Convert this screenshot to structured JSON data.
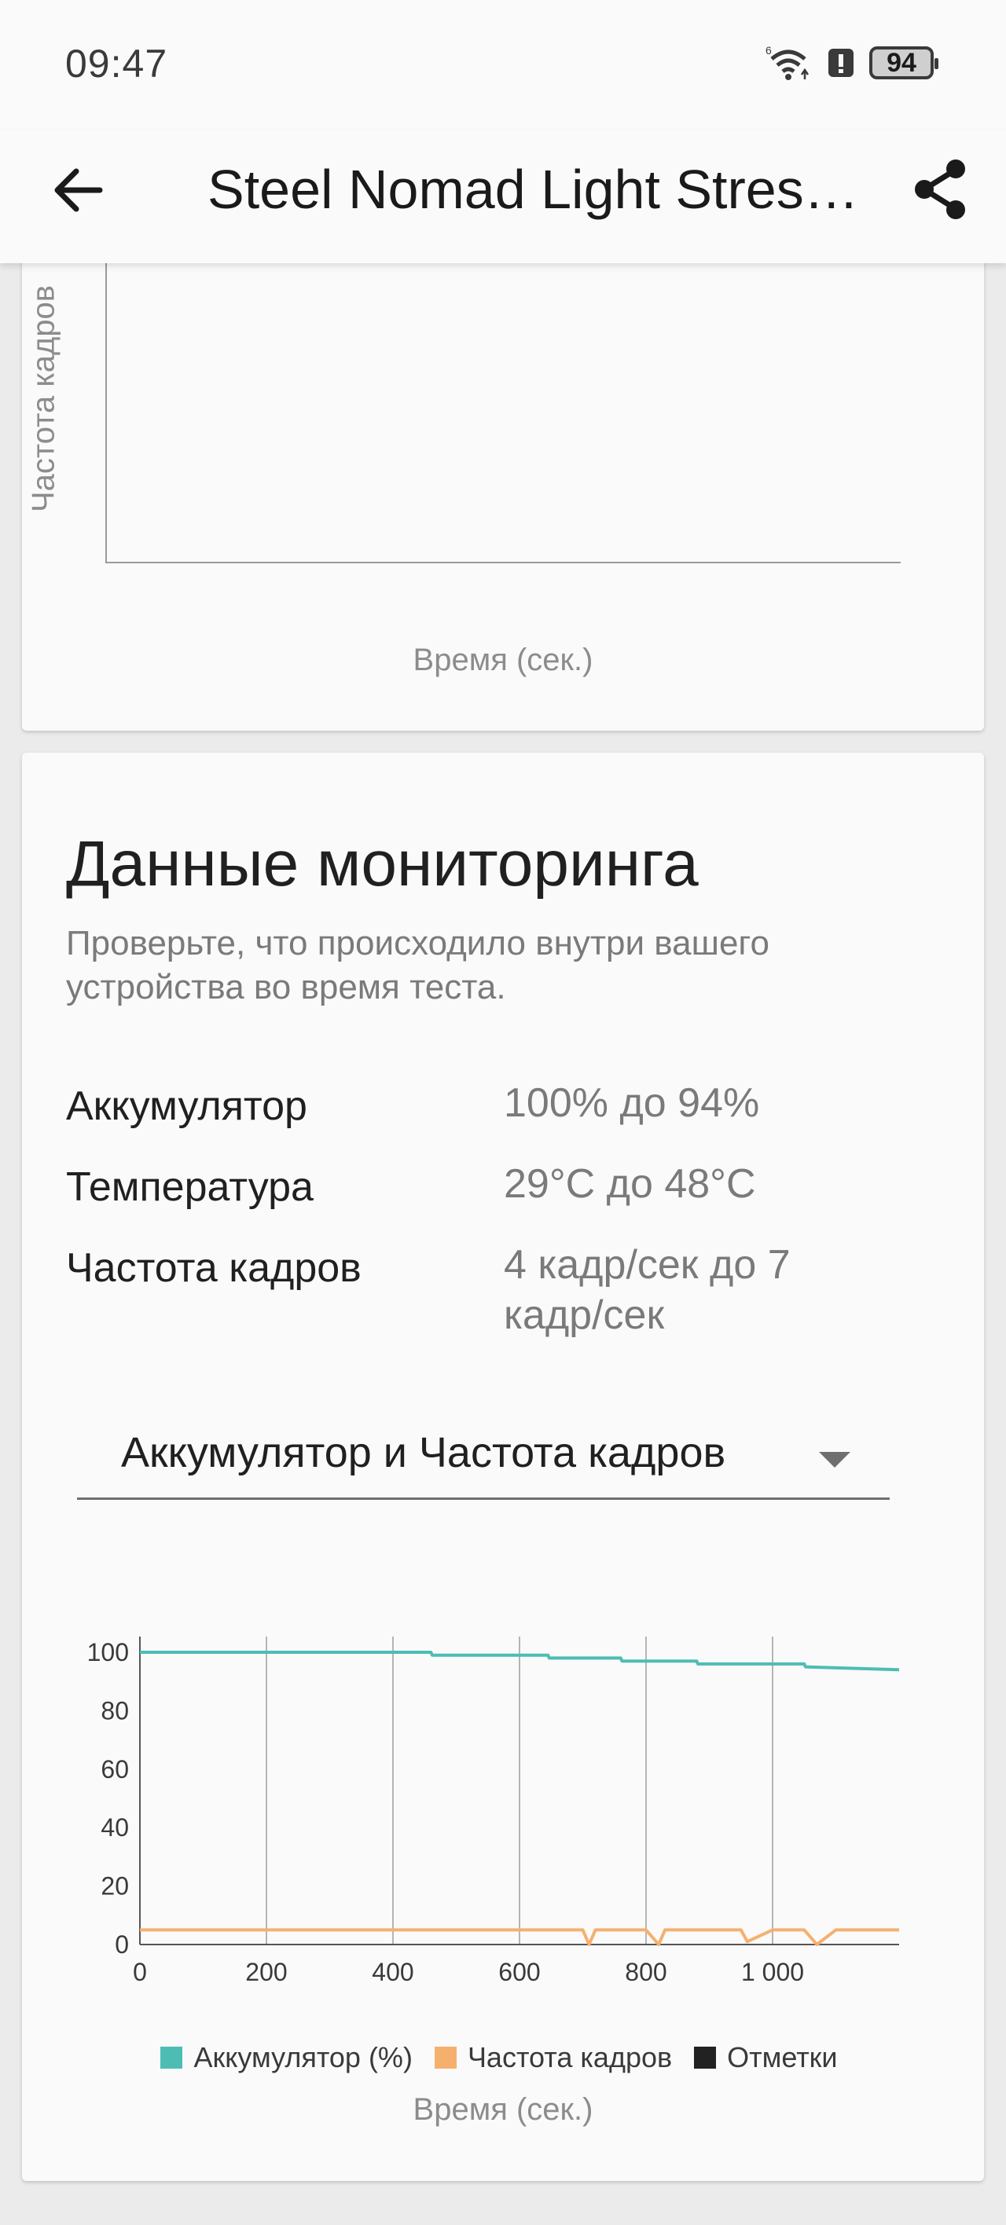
{
  "status": {
    "time": "09:47",
    "battery": "94"
  },
  "toolbar": {
    "title": "Steel Nomad Light Stres…"
  },
  "top_chart": {
    "y_label": "Частота кадров",
    "x_label": "Время (сек.)"
  },
  "monitoring": {
    "title": "Данные мониторинга",
    "subtitle": "Проверьте, что происходило внутри вашего устройства во время теста.",
    "stats": [
      {
        "label": "Аккумулятор",
        "value": "100% до 94%"
      },
      {
        "label": "Температура",
        "value": "29°C до 48°C"
      },
      {
        "label": "Частота кадров",
        "value": "4 кадр/сек до 7 кадр/сек"
      }
    ],
    "dropdown": {
      "selected": "Аккумулятор и Частота кадров"
    }
  },
  "colors": {
    "battery": "#4dbdb4",
    "fps": "#f5b06e",
    "marks": "#222222"
  },
  "chart_data": {
    "type": "line",
    "x_ticks": [
      "0",
      "200",
      "400",
      "600",
      "800",
      "1 000"
    ],
    "y_ticks": [
      "0",
      "20",
      "40",
      "60",
      "80",
      "100"
    ],
    "xlim": [
      0,
      1200
    ],
    "ylim": [
      0,
      100
    ],
    "grid": "vertical",
    "legend_position": "bottom",
    "xlabel": "Время (сек.)",
    "series": [
      {
        "name": "Аккумулятор (%)",
        "x": [
          0,
          460,
          462,
          645,
          647,
          760,
          762,
          880,
          882,
          1050,
          1052,
          1200
        ],
        "y": [
          100,
          100,
          99,
          99,
          98,
          98,
          97,
          97,
          96,
          96,
          95,
          94
        ]
      },
      {
        "name": "Частота кадров",
        "x": [
          0,
          100,
          200,
          300,
          400,
          500,
          600,
          700,
          710,
          720,
          800,
          820,
          830,
          900,
          950,
          960,
          1000,
          1050,
          1070,
          1100,
          1200
        ],
        "y": [
          5,
          5,
          5,
          5,
          5,
          5,
          5,
          5,
          0,
          5,
          5,
          0,
          5,
          5,
          5,
          1,
          5,
          5,
          0,
          5,
          5
        ]
      },
      {
        "name": "Отметки",
        "x": [],
        "y": []
      }
    ]
  }
}
